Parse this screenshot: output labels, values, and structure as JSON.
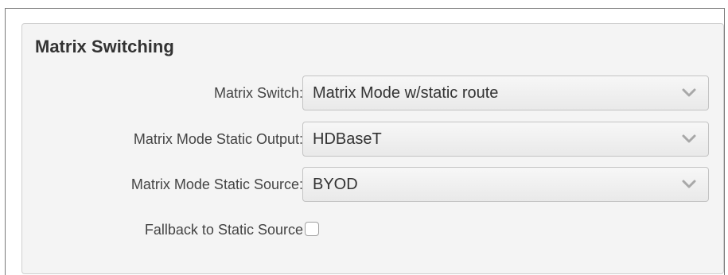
{
  "section": {
    "title": "Matrix Switching"
  },
  "fields": {
    "matrix_switch": {
      "label": "Matrix Switch:",
      "value": "Matrix Mode w/static route"
    },
    "static_output": {
      "label": "Matrix Mode Static Output:",
      "value": "HDBaseT"
    },
    "static_source": {
      "label": "Matrix Mode Static Source:",
      "value": "BYOD"
    },
    "fallback": {
      "label": "Fallback to Static Source",
      "checked": false
    }
  },
  "icons": {
    "dropdown": "chevron-down-icon"
  },
  "colors": {
    "panel_background": "#f4f4f4",
    "chevron": "#a8a8a8"
  }
}
